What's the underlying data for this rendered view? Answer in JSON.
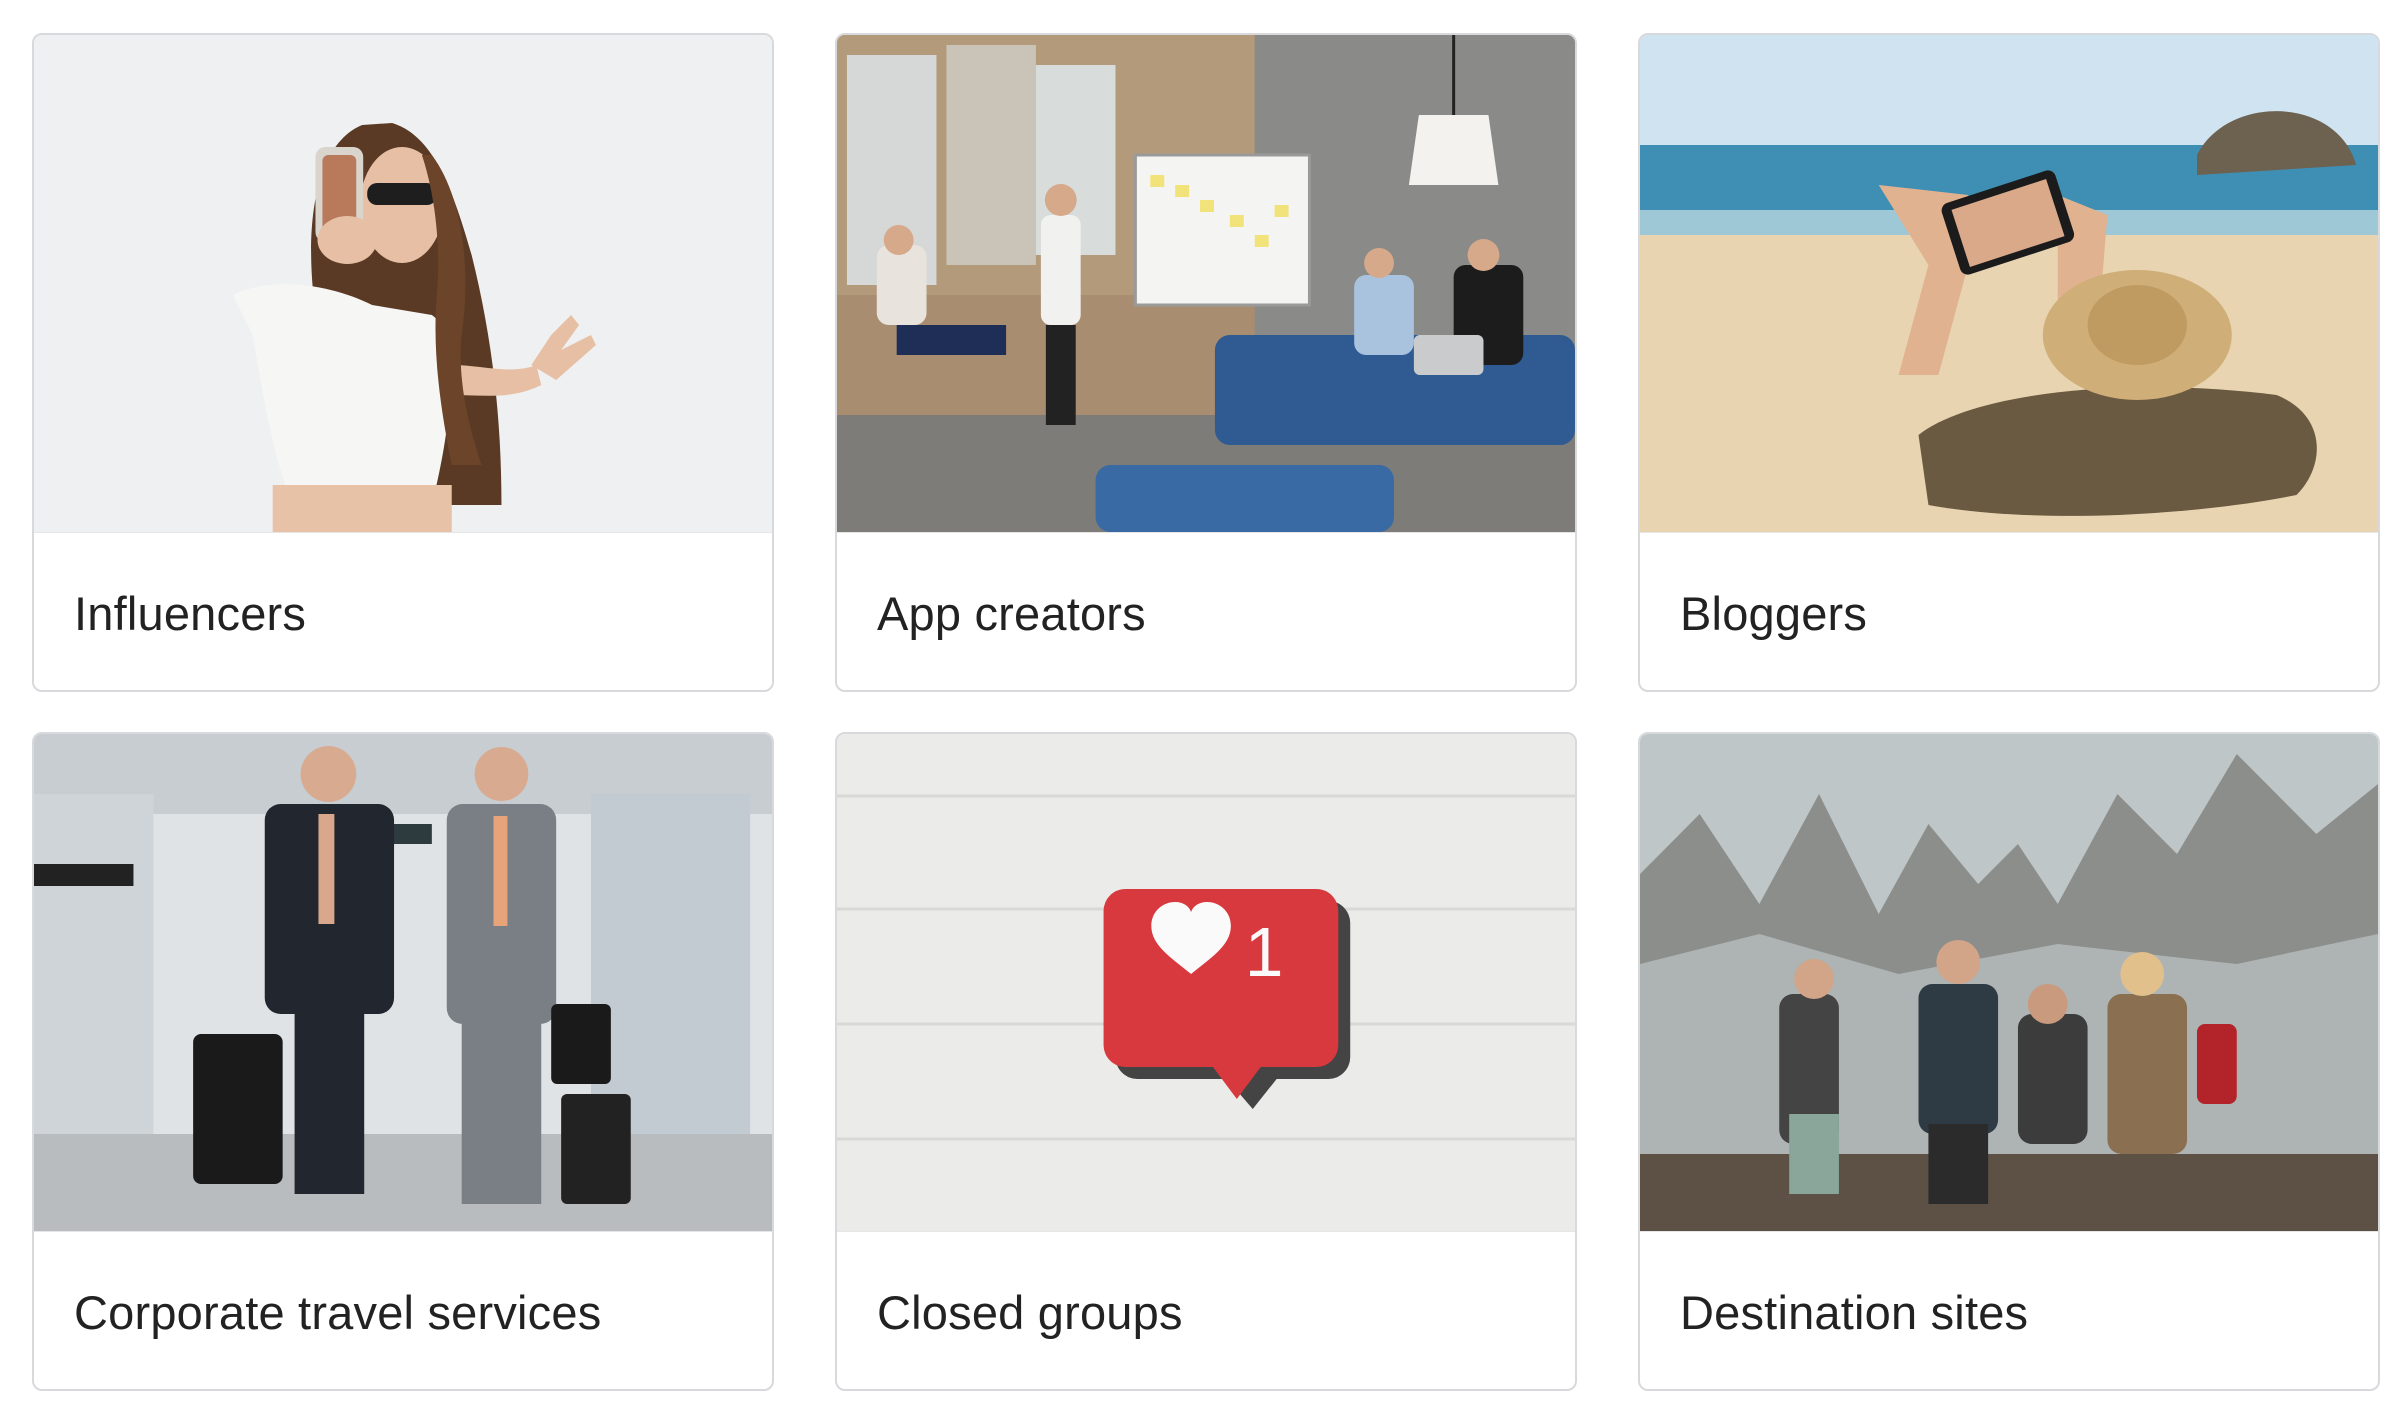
{
  "cards": [
    {
      "title": "Influencers",
      "image": "woman-taking-selfie-photo"
    },
    {
      "title": "App creators",
      "image": "team-meeting-whiteboard-photo"
    },
    {
      "title": "Bloggers",
      "image": "person-on-beach-with-tablet-photo"
    },
    {
      "title": "Corporate travel services",
      "image": "businessmen-in-airport-photo"
    },
    {
      "title": "Closed groups",
      "image": "like-notification-on-brick-wall-photo"
    },
    {
      "title": "Destination sites",
      "image": "hikers-in-mountains-photo"
    }
  ]
}
